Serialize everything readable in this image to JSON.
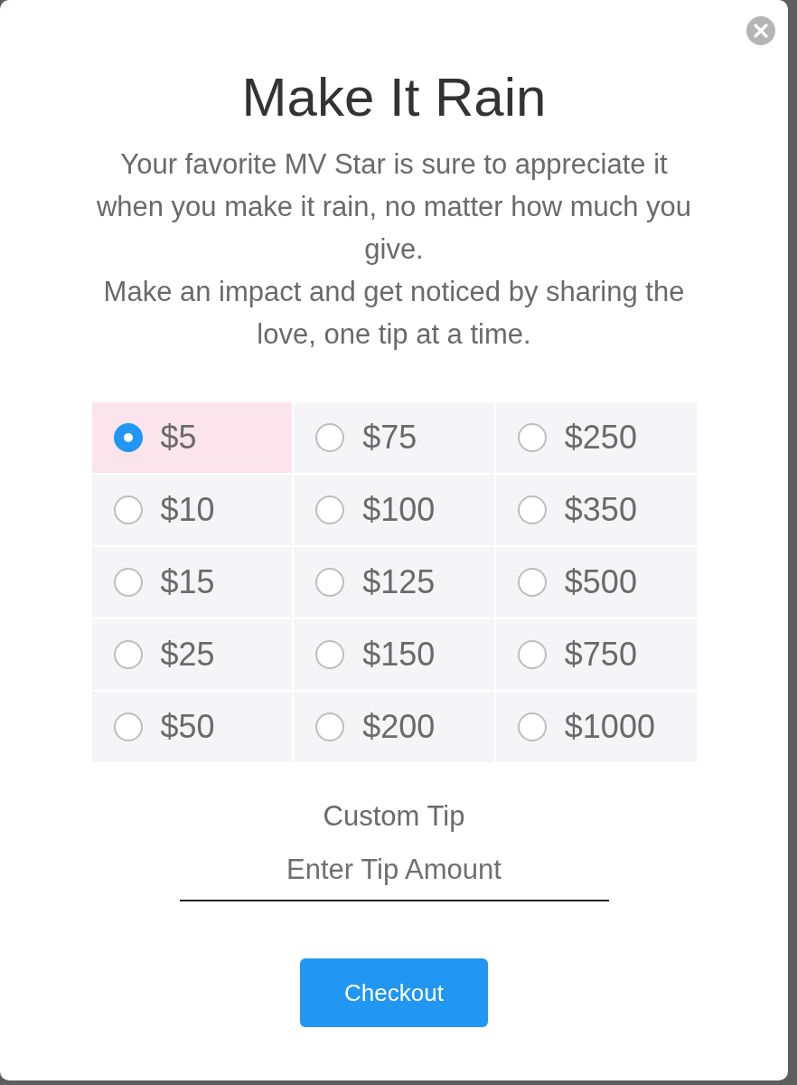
{
  "dialog": {
    "title": "Make It Rain",
    "description": [
      "Your favorite MV Star is sure to appreciate it when you make it rain, no matter how much you give.",
      "Make an impact and get noticed by sharing the love, one tip at a time."
    ]
  },
  "tip_options": [
    {
      "label": "$5",
      "selected": true
    },
    {
      "label": "$75",
      "selected": false
    },
    {
      "label": "$250",
      "selected": false
    },
    {
      "label": "$10",
      "selected": false
    },
    {
      "label": "$100",
      "selected": false
    },
    {
      "label": "$350",
      "selected": false
    },
    {
      "label": "$15",
      "selected": false
    },
    {
      "label": "$125",
      "selected": false
    },
    {
      "label": "$500",
      "selected": false
    },
    {
      "label": "$25",
      "selected": false
    },
    {
      "label": "$150",
      "selected": false
    },
    {
      "label": "$750",
      "selected": false
    },
    {
      "label": "$50",
      "selected": false
    },
    {
      "label": "$200",
      "selected": false
    },
    {
      "label": "$1000",
      "selected": false
    }
  ],
  "custom_tip": {
    "label": "Custom Tip",
    "placeholder": "Enter Tip Amount"
  },
  "checkout_button": {
    "label": "Checkout"
  }
}
